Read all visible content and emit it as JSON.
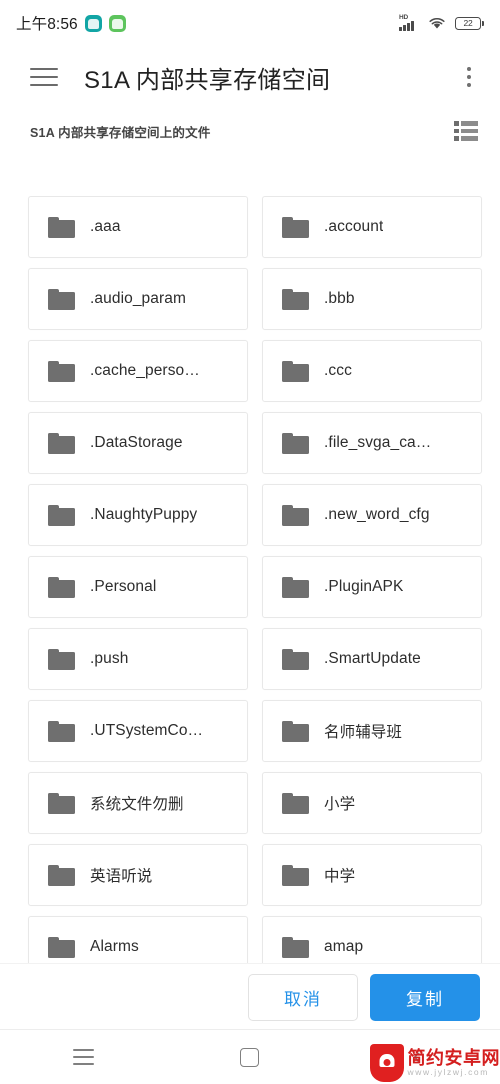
{
  "status_bar": {
    "clock": "上午8:56",
    "app_icons": [
      "app-icon-teal",
      "app-icon-green"
    ],
    "signal_label": "HD",
    "battery_level": "22",
    "icons": [
      "signal-icon",
      "wifi-icon",
      "battery-icon"
    ]
  },
  "app_bar": {
    "menu_icon": "hamburger-menu-icon",
    "title": "S1A 内部共享存储空间",
    "overflow_icon": "overflow-menu-icon"
  },
  "sub_header": {
    "title": "S1A 内部共享存储空间上的文件",
    "view_toggle_icon": "list-view-icon"
  },
  "files": [
    {
      "name": ".aaa",
      "icon": "folder-icon"
    },
    {
      "name": ".account",
      "icon": "folder-icon"
    },
    {
      "name": ".audio_param",
      "icon": "folder-icon"
    },
    {
      "name": ".bbb",
      "icon": "folder-icon"
    },
    {
      "name": ".cache_perso…",
      "icon": "folder-icon"
    },
    {
      "name": ".ccc",
      "icon": "folder-icon"
    },
    {
      "name": ".DataStorage",
      "icon": "folder-icon"
    },
    {
      "name": ".file_svga_ca…",
      "icon": "folder-icon"
    },
    {
      "name": ".NaughtyPuppy",
      "icon": "folder-icon"
    },
    {
      "name": ".new_word_cfg",
      "icon": "folder-icon"
    },
    {
      "name": ".Personal",
      "icon": "folder-icon"
    },
    {
      "name": ".PluginAPK",
      "icon": "folder-icon"
    },
    {
      "name": ".push",
      "icon": "folder-icon"
    },
    {
      "name": ".SmartUpdate",
      "icon": "folder-icon"
    },
    {
      "name": ".UTSystemCo…",
      "icon": "folder-icon"
    },
    {
      "name": "名师辅导班",
      "icon": "folder-icon"
    },
    {
      "name": "系统文件勿删",
      "icon": "folder-icon"
    },
    {
      "name": "小学",
      "icon": "folder-icon"
    },
    {
      "name": "英语听说",
      "icon": "folder-icon"
    },
    {
      "name": "中学",
      "icon": "folder-icon"
    },
    {
      "name": "Alarms",
      "icon": "folder-icon"
    },
    {
      "name": "amap",
      "icon": "folder-icon"
    }
  ],
  "action_bar": {
    "cancel_label": "取消",
    "copy_label": "复制"
  },
  "nav_bar": {
    "recents_icon": "recents-icon",
    "home_icon": "home-icon",
    "back_icon": "back-icon",
    "back_glyph": "‹"
  },
  "watermark": {
    "title": "简约安卓网",
    "url": "www.jylzwj.com",
    "logo_icon": "android-shield-logo-icon"
  },
  "colors": {
    "accent_blue": "#2491e8",
    "folder_gray": "#6f6f6f",
    "watermark_red": "#e02020"
  }
}
